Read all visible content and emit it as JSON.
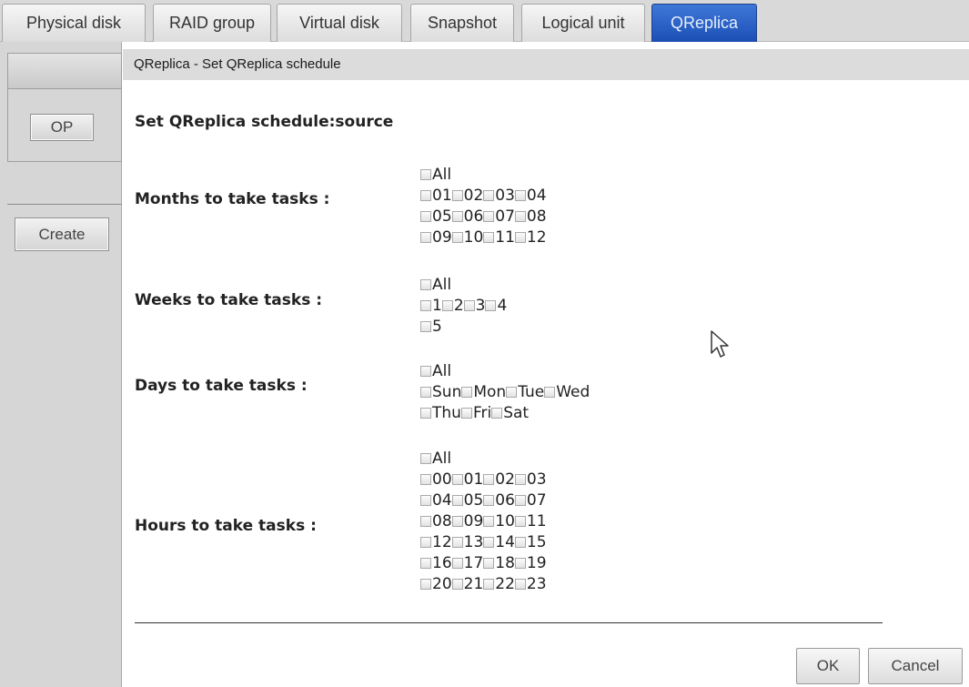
{
  "tabs": [
    {
      "label": "Physical disk",
      "active": false
    },
    {
      "label": "RAID group",
      "active": false
    },
    {
      "label": "Virtual disk",
      "active": false
    },
    {
      "label": "Snapshot",
      "active": false
    },
    {
      "label": "Logical unit",
      "active": false
    },
    {
      "label": "QReplica",
      "active": true
    }
  ],
  "sidebar": {
    "op_label": "OP",
    "create_label": "Create"
  },
  "panel": {
    "header": "QReplica - Set QReplica schedule",
    "heading": "Set QReplica schedule:source"
  },
  "months": {
    "label": "Months to take tasks :",
    "all": "All",
    "rows": [
      [
        "01",
        "02",
        "03",
        "04"
      ],
      [
        "05",
        "06",
        "07",
        "08"
      ],
      [
        "09",
        "10",
        "11",
        "12"
      ]
    ]
  },
  "weeks": {
    "label": "Weeks to take tasks :",
    "all": "All",
    "rows": [
      [
        "1",
        "2",
        "3",
        "4"
      ],
      [
        "5"
      ]
    ]
  },
  "days": {
    "label": "Days to take tasks :",
    "all": "All",
    "rows": [
      [
        "Sun",
        "Mon",
        "Tue",
        "Wed"
      ],
      [
        "Thu",
        "Fri",
        "Sat"
      ]
    ]
  },
  "hours": {
    "label": "Hours to take tasks :",
    "all": "All",
    "rows": [
      [
        "00",
        "01",
        "02",
        "03"
      ],
      [
        "04",
        "05",
        "06",
        "07"
      ],
      [
        "08",
        "09",
        "10",
        "11"
      ],
      [
        "12",
        "13",
        "14",
        "15"
      ],
      [
        "16",
        "17",
        "18",
        "19"
      ],
      [
        "20",
        "21",
        "22",
        "23"
      ]
    ]
  },
  "buttons": {
    "ok": "OK",
    "cancel": "Cancel"
  },
  "colors": {
    "active_tab": "#2a62c9",
    "sidebar": "#d6d6d6",
    "header_bar": "#dcdcdc"
  }
}
